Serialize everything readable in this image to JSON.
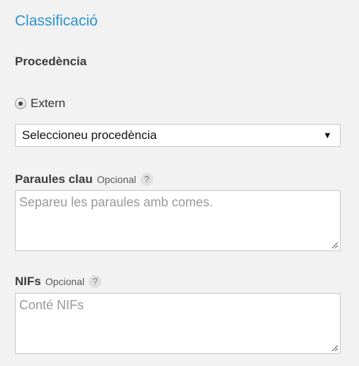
{
  "section": {
    "title": "Classificació"
  },
  "procedencia": {
    "label": "Procedència",
    "radio_label": "Extern",
    "select_value": "Seleccioneu procedència",
    "select_arrow": "▼"
  },
  "paraules_clau": {
    "label": "Paraules clau",
    "optional": "Opcional",
    "help": "?",
    "placeholder": "Separeu les paraules amb comes."
  },
  "nifs": {
    "label": "NIFs",
    "optional": "Opcional",
    "help": "?",
    "placeholder": "Conté NIFs"
  },
  "icons": {
    "radio": "radio-selected-icon",
    "dropdown": "triangle-down-icon",
    "help": "question-mark-icon",
    "resize": "resize-grip-icon"
  },
  "colors": {
    "accent": "#2a93cf",
    "background": "#f2f2f2",
    "label": "#3c3c3c",
    "placeholder": "#999999"
  }
}
